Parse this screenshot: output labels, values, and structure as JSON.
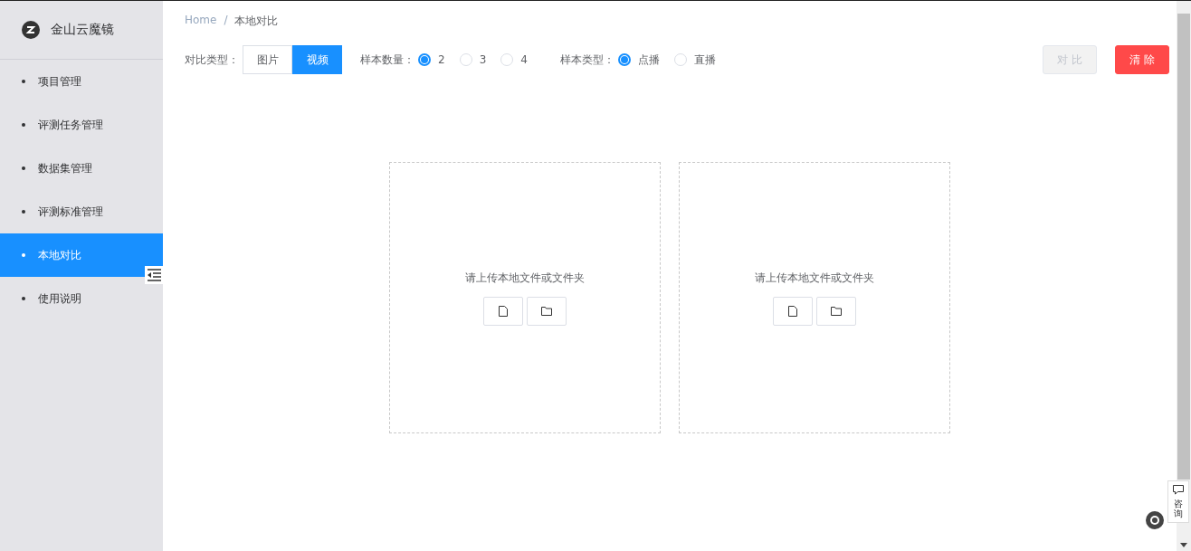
{
  "sidebar": {
    "logo_text": "金山云魔镜",
    "items": [
      {
        "label": "项目管理",
        "selected": false
      },
      {
        "label": "评测任务管理",
        "selected": false
      },
      {
        "label": "数据集管理",
        "selected": false
      },
      {
        "label": "评测标准管理",
        "selected": false
      },
      {
        "label": "本地对比",
        "selected": true
      },
      {
        "label": "使用说明",
        "selected": false
      }
    ]
  },
  "breadcrumb": [
    "Home",
    "本地对比"
  ],
  "breadcrumb_separator": "/",
  "compare_type": {
    "label": "对比类型：",
    "options": [
      {
        "label": "图片",
        "selected": false
      },
      {
        "label": "视频",
        "selected": true
      }
    ]
  },
  "radio_groups": [
    {
      "label": "样本数量：",
      "options": [
        {
          "label": "2",
          "selected": true
        },
        {
          "label": "3",
          "selected": false
        },
        {
          "label": "4",
          "selected": false
        }
      ]
    },
    {
      "label": "样本类型：",
      "options": [
        {
          "label": "点播",
          "selected": true
        },
        {
          "label": "直播",
          "selected": false
        }
      ]
    }
  ],
  "buttons": [
    {
      "label": "对 比",
      "kind": "default",
      "disabled": true
    },
    {
      "label": "清 除",
      "kind": "danger",
      "disabled": false
    }
  ],
  "upload_boxes": [
    {
      "prompt": "请上传本地文件或文件夹"
    },
    {
      "prompt": "请上传本地文件或文件夹"
    }
  ],
  "consult_widget": {
    "label": "咨询"
  }
}
